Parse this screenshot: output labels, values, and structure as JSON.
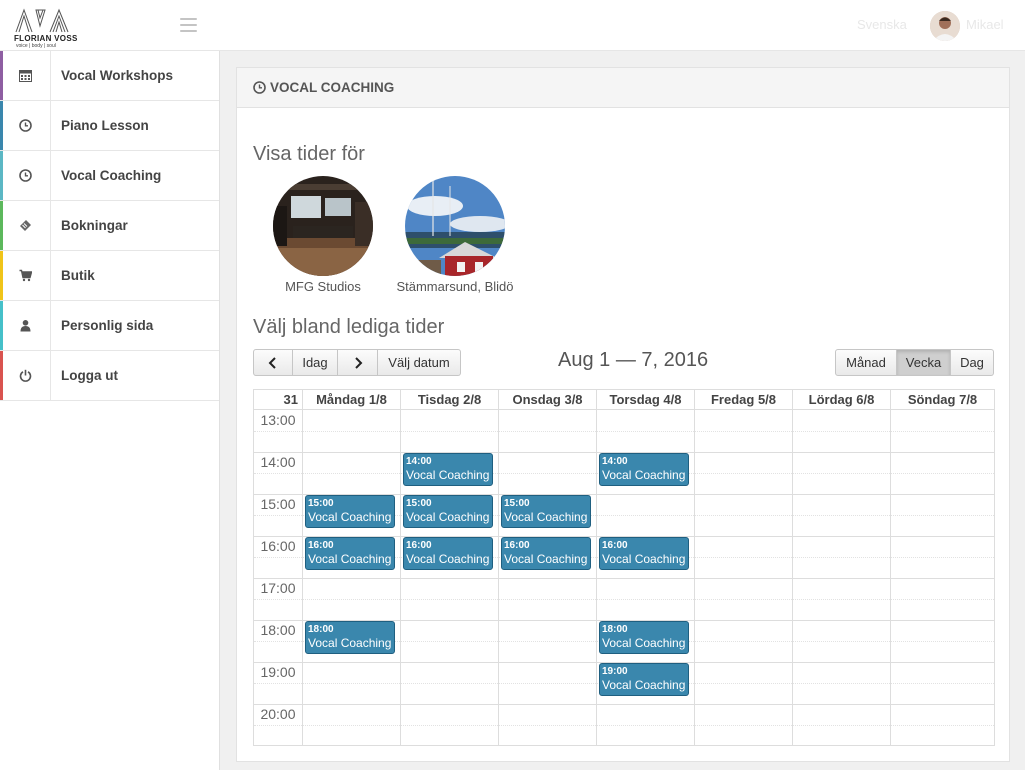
{
  "header": {
    "logo_name": "FLORIAN VOSS",
    "logo_tagline": "voice | body | soul",
    "language": "Svenska",
    "username": "Mikael"
  },
  "sidebar": {
    "items": [
      {
        "label": "Vocal Workshops",
        "icon": "calendar-icon",
        "color": "#8e5ea2"
      },
      {
        "label": "Piano Lesson",
        "icon": "clock-icon",
        "color": "#3a87ad"
      },
      {
        "label": "Vocal Coaching",
        "icon": "clock-icon",
        "color": "#5bb7c4"
      },
      {
        "label": "Bokningar",
        "icon": "ticket-icon",
        "color": "#5cb85c"
      },
      {
        "label": "Butik",
        "icon": "cart-icon",
        "color": "#f0c419"
      },
      {
        "label": "Personlig sida",
        "icon": "user-icon",
        "color": "#45c0c9"
      },
      {
        "label": "Logga ut",
        "icon": "power-icon",
        "color": "#d9534f"
      }
    ]
  },
  "panel": {
    "title": "VOCAL COACHING",
    "show_times_heading": "Visa tider för",
    "locations": [
      {
        "name": "MFG Studios"
      },
      {
        "name": "Stämmarsund, Blidö"
      }
    ],
    "choose_heading": "Välj bland lediga tider"
  },
  "toolbar": {
    "prev": "‹",
    "today": "Idag",
    "next": "›",
    "pick_date": "Välj datum",
    "range_title": "Aug 1 — 7, 2016",
    "views": [
      "Månad",
      "Vecka",
      "Dag"
    ],
    "active_view": "Vecka"
  },
  "calendar": {
    "week_number": "31",
    "days": [
      "Måndag 1/8",
      "Tisdag 2/8",
      "Onsdag 3/8",
      "Torsdag 4/8",
      "Fredag 5/8",
      "Lördag 6/8",
      "Söndag 7/8"
    ],
    "hours": [
      "13:00",
      "14:00",
      "15:00",
      "16:00",
      "17:00",
      "18:00",
      "19:00",
      "20:00"
    ],
    "events": [
      {
        "day": 1,
        "time": "14:00",
        "title": "Vocal Coaching"
      },
      {
        "day": 3,
        "time": "14:00",
        "title": "Vocal Coaching"
      },
      {
        "day": 0,
        "time": "15:00",
        "title": "Vocal Coaching"
      },
      {
        "day": 1,
        "time": "15:00",
        "title": "Vocal Coaching"
      },
      {
        "day": 2,
        "time": "15:00",
        "title": "Vocal Coaching"
      },
      {
        "day": 0,
        "time": "16:00",
        "title": "Vocal Coaching"
      },
      {
        "day": 1,
        "time": "16:00",
        "title": "Vocal Coaching"
      },
      {
        "day": 2,
        "time": "16:00",
        "title": "Vocal Coaching"
      },
      {
        "day": 3,
        "time": "16:00",
        "title": "Vocal Coaching"
      },
      {
        "day": 0,
        "time": "18:00",
        "title": "Vocal Coaching"
      },
      {
        "day": 3,
        "time": "18:00",
        "title": "Vocal Coaching"
      },
      {
        "day": 3,
        "time": "19:00",
        "title": "Vocal Coaching"
      }
    ],
    "event_color": "#3a87ad"
  }
}
